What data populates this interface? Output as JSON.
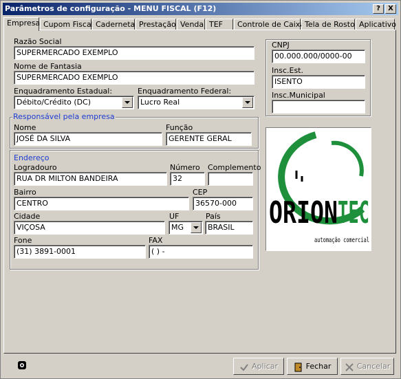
{
  "window": {
    "title": "Parâmetros de configuração - MENU FISCAL (F12)",
    "help_label": "?",
    "close_label": "X"
  },
  "tabs": [
    {
      "label": "Empresa"
    },
    {
      "label": "Cupom Fiscal"
    },
    {
      "label": "Caderneta"
    },
    {
      "label": "Prestação"
    },
    {
      "label": "Venda"
    },
    {
      "label": "TEF"
    },
    {
      "label": "Controle de Caixa"
    },
    {
      "label": "Tela de Rosto"
    },
    {
      "label": "Aplicativo"
    }
  ],
  "form": {
    "razao_social_label": "Razão Social",
    "razao_social_value": "SUPERMERCADO EXEMPLO",
    "nome_fantasia_label": "Nome de Fantasia",
    "nome_fantasia_value": "SUPERMERCADO EXEMPLO",
    "enq_estadual_label": "Enquadramento Estadual:",
    "enq_estadual_value": "Débito/Crédito (DC)",
    "enq_federal_label": "Enquadramento Federal:",
    "enq_federal_value": "Lucro Real",
    "cnpj_label": "CNPJ",
    "cnpj_value": "00.000.000/0000-00",
    "insc_est_label": "Insc.Est.",
    "insc_est_value": "ISENTO",
    "insc_mun_label": "Insc.Municipal",
    "insc_mun_value": ""
  },
  "responsavel": {
    "title": "Responsável pela empresa",
    "nome_label": "Nome",
    "nome_value": "JOSÉ DA SILVA",
    "funcao_label": "Função",
    "funcao_value": "GERENTE GERAL"
  },
  "endereco": {
    "title": "Endereço",
    "logradouro_label": "Logradouro",
    "logradouro_value": "RUA DR MILTON BANDEIRA",
    "numero_label": "Número",
    "numero_value": "32",
    "complemento_label": "Complemento",
    "complemento_value": "",
    "bairro_label": "Bairro",
    "bairro_value": "CENTRO",
    "cep_label": "CEP",
    "cep_value": "36570-000",
    "cidade_label": "Cidade",
    "cidade_value": "VIÇOSA",
    "uf_label": "UF",
    "uf_value": "MG",
    "pais_label": "País",
    "pais_value": "BRASIL",
    "fone_label": "Fone",
    "fone_value": "(31) 3891-0001",
    "fax_label": "FAX",
    "fax_value": "(  )    -"
  },
  "logo": {
    "brand_a": "ORION",
    "brand_b": "TEC",
    "tagline": "automação comercial"
  },
  "buttons": {
    "aplicar": "Aplicar",
    "fechar": "Fechar",
    "cancelar": "Cancelar"
  },
  "colors": {
    "title_start": "#0a246a",
    "title_end": "#a6caf0",
    "group_title": "#1c3bd0",
    "logo_green": "#1e8f3a"
  }
}
